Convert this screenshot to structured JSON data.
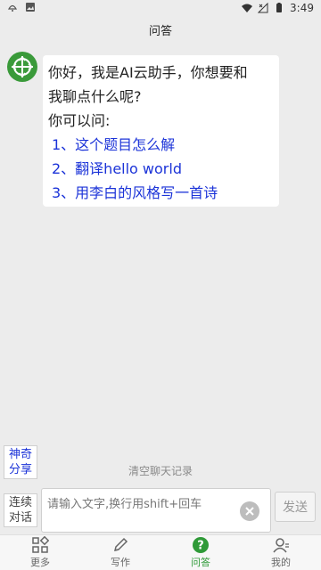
{
  "status_bar": {
    "time": "3:49",
    "left_icons": [
      "notification-icon",
      "image-icon"
    ],
    "right_icons": [
      "wifi-icon",
      "signal-icon",
      "battery-icon"
    ]
  },
  "title": "问答",
  "message": {
    "avatar_icon": "assistant-logo-icon",
    "lines": [
      "你好，我是AI云助手，你想要和",
      "我聊点什么呢?",
      "你可以问:"
    ],
    "questions": [
      "1、这个题目怎么解",
      "2、翻译hello world",
      "3、用李白的风格写一首诗"
    ]
  },
  "magic_share": {
    "line1": "神奇",
    "line2": "分享"
  },
  "clear_history": "清空聊天记录",
  "input_area": {
    "continue_line1": "连续",
    "continue_line2": "对话",
    "placeholder": "请输入文字,换行用shift+回车",
    "send": "发送"
  },
  "nav": {
    "items": [
      {
        "label": "更多",
        "icon": "grid-icon"
      },
      {
        "label": "写作",
        "icon": "pen-icon"
      },
      {
        "label": "问答",
        "icon": "question-icon"
      },
      {
        "label": "我的",
        "icon": "user-icon"
      }
    ],
    "active_index": 2,
    "active_color": "#2f9a38"
  },
  "colors": {
    "question_text": "#1b33d8",
    "accent": "#2f9a38"
  }
}
